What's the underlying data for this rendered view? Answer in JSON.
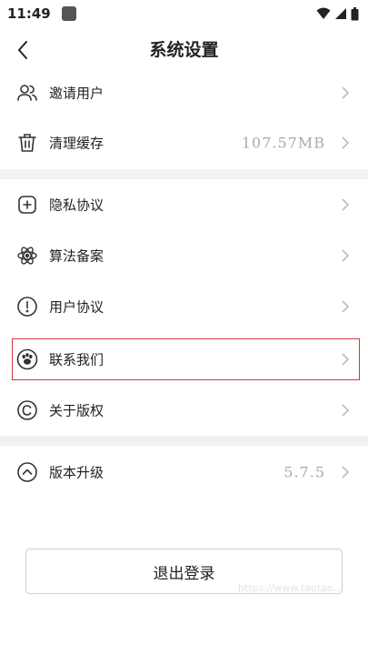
{
  "status_bar": {
    "time": "11:49",
    "icons": [
      "app-notification-icon",
      "wifi-icon",
      "signal-icon",
      "battery-icon"
    ]
  },
  "header": {
    "title": "系统设置",
    "back_icon": "chevron-left-icon"
  },
  "groups": [
    [
      {
        "id": "invite-users",
        "label": "邀请用户",
        "icon": "users-icon",
        "value": ""
      },
      {
        "id": "clear-cache",
        "label": "清理缓存",
        "icon": "trash-icon",
        "value": "107.57MB"
      }
    ],
    [
      {
        "id": "privacy-policy",
        "label": "隐私协议",
        "icon": "plus-square-icon",
        "value": ""
      },
      {
        "id": "algorithm-filing",
        "label": "算法备案",
        "icon": "atom-icon",
        "value": ""
      },
      {
        "id": "user-agreement",
        "label": "用户协议",
        "icon": "alert-circle-icon",
        "value": ""
      },
      {
        "id": "contact-us",
        "label": "联系我们",
        "icon": "paw-icon",
        "value": ""
      },
      {
        "id": "about-copyright",
        "label": "关于版权",
        "icon": "copyright-icon",
        "value": ""
      }
    ],
    [
      {
        "id": "version-upgrade",
        "label": "版本升级",
        "icon": "chevron-up-circle-icon",
        "value": "5.7.5"
      }
    ]
  ],
  "logout_label": "退出登录",
  "watermark_text": "https://www.taotao...",
  "colors": {
    "highlight": "#d9333a",
    "divider": "#f2f2f2",
    "value_text": "#aaaaaa"
  }
}
